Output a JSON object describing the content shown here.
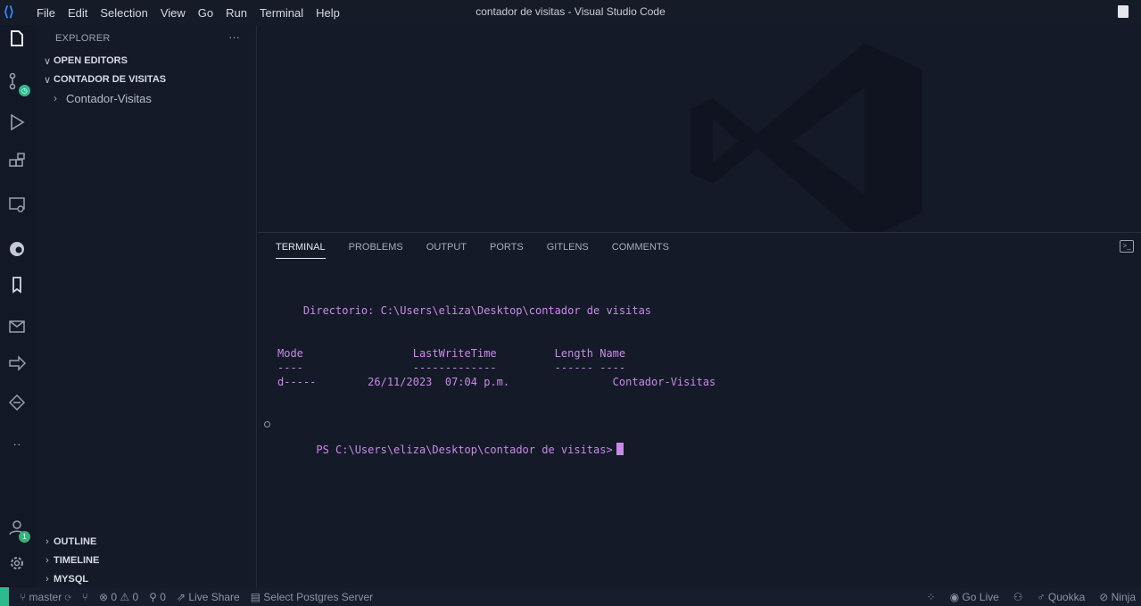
{
  "titlebar": {
    "menu": [
      "File",
      "Edit",
      "Selection",
      "View",
      "Go",
      "Run",
      "Terminal",
      "Help"
    ],
    "window_title": "contador de visitas - Visual Studio Code"
  },
  "activity_bar": {
    "items": [
      "files-icon",
      "source-control-icon",
      "run-debug-icon",
      "extensions-icon",
      "remote-explorer-icon",
      "edge-icon",
      "bookmark-icon",
      "mail-icon",
      "share-icon",
      "gitlens-icon",
      "more-icon",
      "accounts-icon",
      "settings-gear-icon"
    ],
    "accounts_badge": "1"
  },
  "sidebar": {
    "title": "EXPLORER",
    "more": "···",
    "sections": {
      "open_editors": "OPEN EDITORS",
      "project": "CONTADOR DE VISITAS",
      "outline": "OUTLINE",
      "timeline": "TIMELINE",
      "mysql": "MYSQL"
    },
    "tree_item": "Contador-Visitas",
    "chev_open": "∨",
    "chev_closed": "›"
  },
  "panel": {
    "tabs": [
      "TERMINAL",
      "PROBLEMS",
      "OUTPUT",
      "PORTS",
      "GITLENS",
      "COMMENTS"
    ],
    "active_tab": "TERMINAL",
    "action_icon": ">_"
  },
  "terminal": {
    "directory": "    Directorio: C:\\Users\\eliza\\Desktop\\contador de visitas",
    "header": "Mode                 LastWriteTime         Length Name",
    "separator": "----                 -------------         ------ ----",
    "row": "d-----        26/11/2023  07:04 p.m.                Contador-Visitas",
    "prompt": "PS C:\\Users\\eliza\\Desktop\\contador de visitas>"
  },
  "status_bar": {
    "branch": "master",
    "errors": "⊗ 0 ⚠ 0",
    "ports": "0",
    "live_share": "Live Share",
    "postgres": "Select Postgres Server",
    "go_live": "Go Live",
    "quokka": "Quokka",
    "ninja": "Ninja"
  },
  "colors": {
    "background": "#141a28",
    "terminal_text": "#c98ae6",
    "remote_indicator": "#2dbb8e",
    "accent_badge": "#3ab07a"
  }
}
